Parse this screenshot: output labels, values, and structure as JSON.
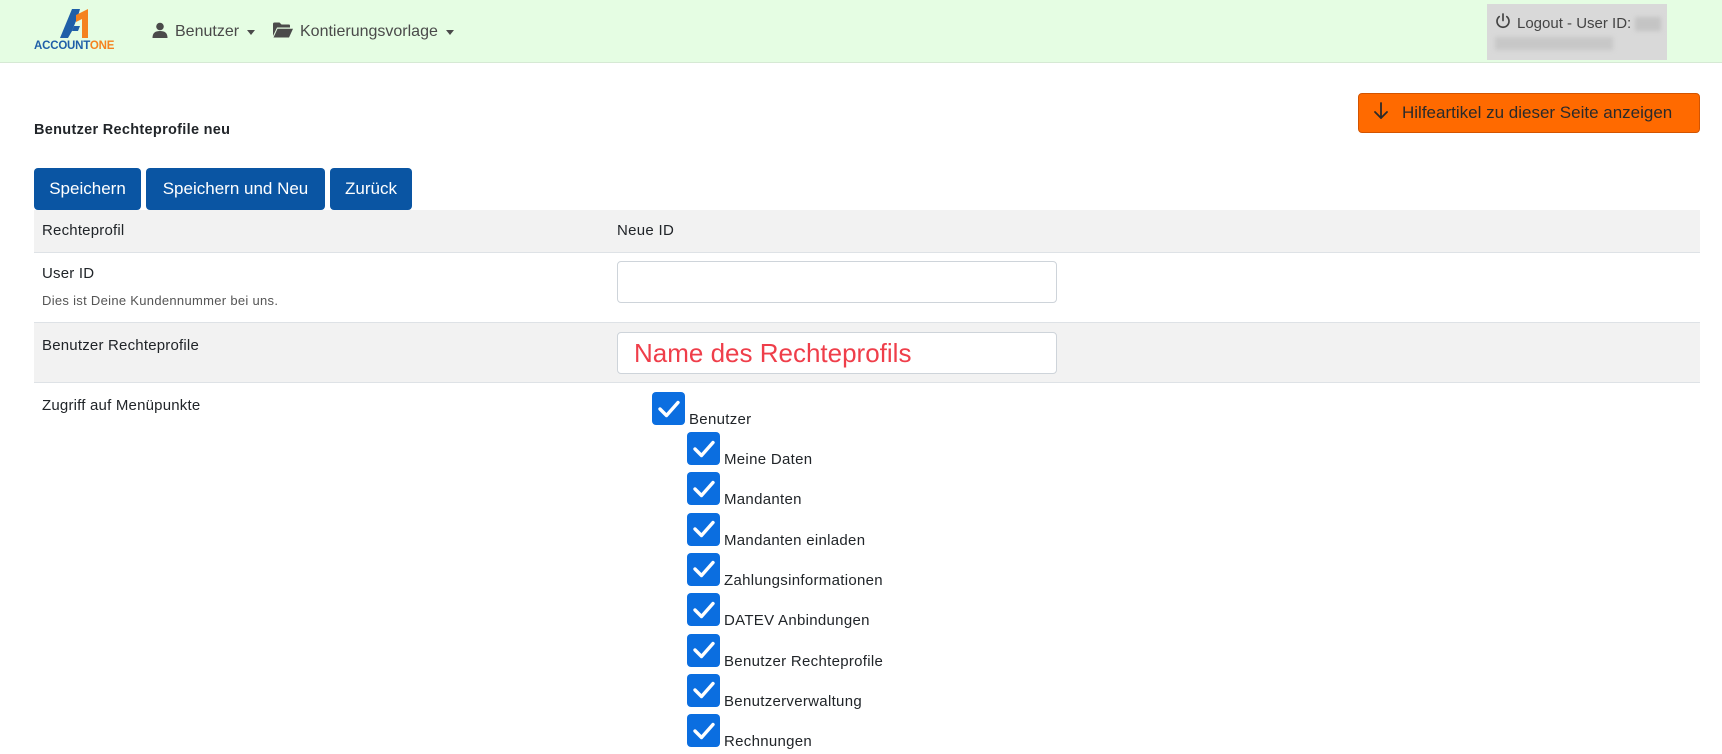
{
  "navbar": {
    "logo_text_account": "ACCOUNT",
    "logo_text_one": "ONE",
    "menu": [
      {
        "label": "Benutzer",
        "icon": "user-icon"
      },
      {
        "label": "Kontierungsvorlage",
        "icon": "folder-open-icon"
      }
    ],
    "logout_label": "Logout - User ID:",
    "logout_icon": "power-icon"
  },
  "help_button": {
    "label": "Hilfeartikel zu dieser Seite anzeigen",
    "icon": "arrow-down-icon"
  },
  "page_title": "Benutzer Rechteprofile neu",
  "actions": {
    "save": "Speichern",
    "save_new": "Speichern und Neu",
    "back": "Zurück"
  },
  "form": {
    "header": {
      "label": "Rechteprofil",
      "value": "Neue ID"
    },
    "user_id": {
      "label": "User ID",
      "hint": "Dies ist Deine Kundennummer bei uns.",
      "value": ""
    },
    "profile_name": {
      "label": "Benutzer Rechteprofile",
      "value": "Name des Rechteprofils"
    },
    "menu_access": {
      "label": "Zugriff auf Menüpunkte",
      "parent": {
        "label": "Benutzer",
        "checked": true
      },
      "children": [
        {
          "label": "Meine Daten",
          "checked": true
        },
        {
          "label": "Mandanten",
          "checked": true
        },
        {
          "label": "Mandanten einladen",
          "checked": true
        },
        {
          "label": "Zahlungsinformationen",
          "checked": true
        },
        {
          "label": "DATEV Anbindungen",
          "checked": true
        },
        {
          "label": "Benutzer Rechteprofile",
          "checked": true
        },
        {
          "label": "Benutzerverwaltung",
          "checked": true
        },
        {
          "label": "Rechnungen",
          "checked": true
        }
      ]
    }
  },
  "colors": {
    "navbar_bg": "#e5fde3",
    "primary": "#0a55a3",
    "help": "#ff6a00",
    "checkbox": "#0b6ee0",
    "name_text": "#ef3e4a"
  }
}
